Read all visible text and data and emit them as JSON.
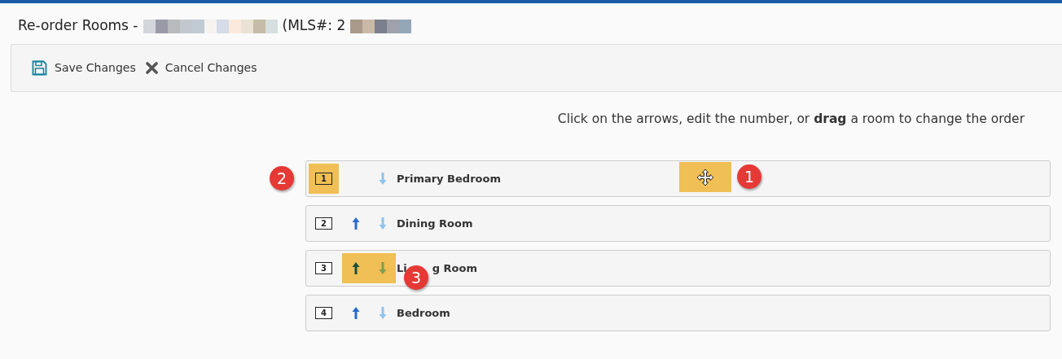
{
  "title": {
    "prefix": "Re-order Rooms -",
    "mls_label": "(MLS#: 2"
  },
  "toolbar": [
    {
      "kind": "save",
      "label": "Save Changes"
    },
    {
      "kind": "cancel",
      "label": "Cancel Changes"
    }
  ],
  "instructions": "Click on the arrows, edit the number, or **drag** a room to change the order",
  "rooms": [
    {
      "number": "1",
      "name": "Primary Bedroom",
      "up_arrow": false,
      "number_highlighted": true,
      "arrows_highlighted": false,
      "drag_handle": true,
      "number_callout": "2",
      "handle_callout": "1"
    },
    {
      "number": "2",
      "name": "Dining Room",
      "up_arrow": true,
      "number_highlighted": false,
      "arrows_highlighted": false,
      "drag_handle": false
    },
    {
      "number": "3",
      "name": "Li",
      "name_after_callout": "g Room",
      "up_arrow": true,
      "number_highlighted": false,
      "arrows_highlighted": true,
      "drag_handle": false,
      "name_callout": "3"
    },
    {
      "number": "4",
      "name": "Bedroom",
      "up_arrow": true,
      "number_highlighted": false,
      "arrows_highlighted": false,
      "drag_handle": false
    }
  ]
}
